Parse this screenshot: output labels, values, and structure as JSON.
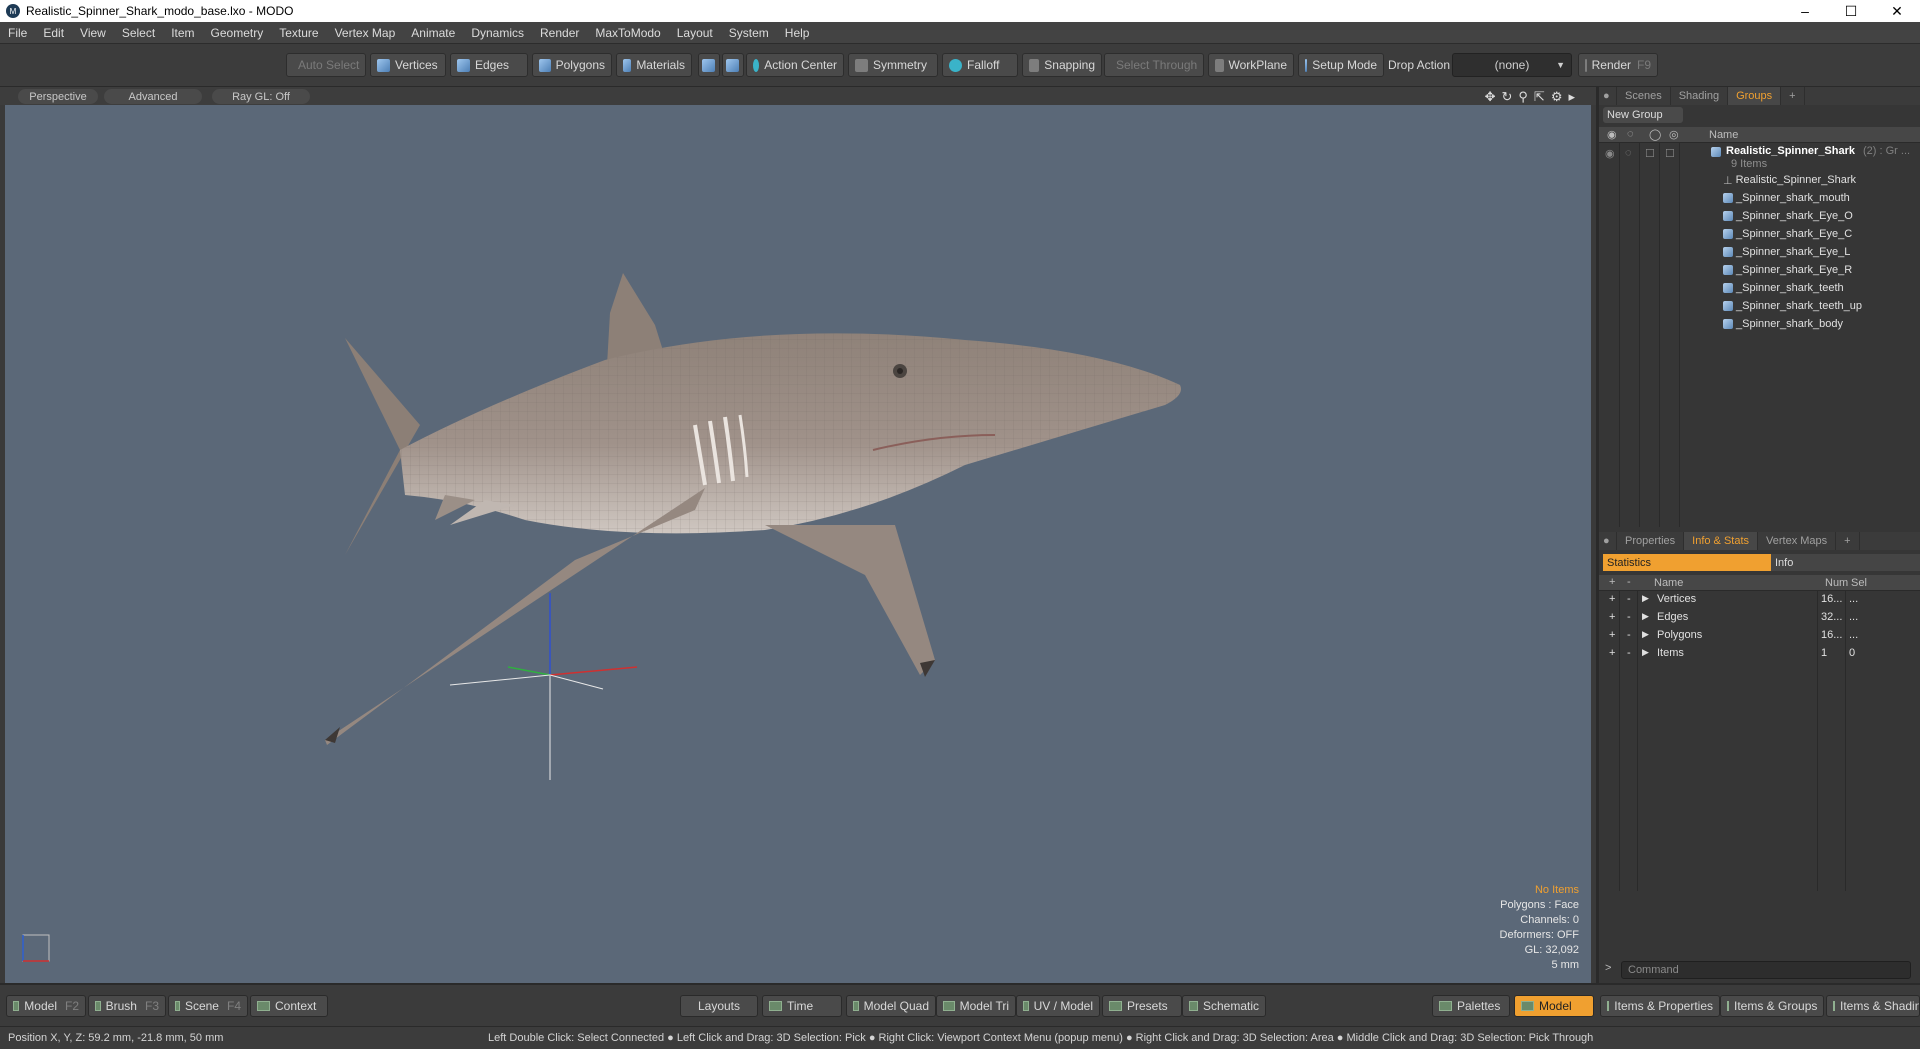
{
  "window": {
    "title": "Realistic_Spinner_Shark_modo_base.lxo - MODO"
  },
  "menu": [
    "File",
    "Edit",
    "View",
    "Select",
    "Item",
    "Geometry",
    "Texture",
    "Vertex Map",
    "Animate",
    "Dynamics",
    "Render",
    "MaxToModo",
    "Layout",
    "System",
    "Help"
  ],
  "toolbar": {
    "auto_select": "Auto Select",
    "vertices": "Vertices",
    "edges": "Edges",
    "polygons": "Polygons",
    "materials": "Materials",
    "action_center": "Action Center",
    "symmetry": "Symmetry",
    "falloff": "Falloff",
    "snapping": "Snapping",
    "select_through": "Select Through",
    "workplane": "WorkPlane",
    "setup_mode": "Setup Mode",
    "drop_action_label": "Drop Action",
    "drop_action_value": "(none)",
    "render": "Render",
    "render_key": "F9"
  },
  "viewport": {
    "tabs": [
      "Perspective",
      "Advanced",
      "Ray GL: Off"
    ],
    "overlay": {
      "no_items": "No Items",
      "polygons": "Polygons : Face",
      "channels": "Channels: 0",
      "deformers": "Deformers: OFF",
      "gl": "GL: 32,092",
      "scale": "5 mm"
    }
  },
  "groups_panel": {
    "tabs": [
      "Scenes",
      "Shading",
      "Groups"
    ],
    "new_group": "New Group",
    "col_name": "Name",
    "root": {
      "name": "Realistic_Spinner_Shark",
      "suffix": "(2) : Gr ...",
      "count": "9 Items"
    },
    "items": [
      "Realistic_Spinner_Shark",
      "_Spinner_shark_mouth",
      "_Spinner_shark_Eye_O",
      "_Spinner_shark_Eye_C",
      "_Spinner_shark_Eye_L",
      "_Spinner_shark_Eye_R",
      "_Spinner_shark_teeth",
      "_Spinner_shark_teeth_up",
      "_Spinner_shark_body"
    ]
  },
  "stats_panel": {
    "tabs": [
      "Properties",
      "Info & Stats",
      "Vertex Maps"
    ],
    "subtabs": [
      "Statistics",
      "Info"
    ],
    "columns": {
      "name": "Name",
      "num": "Num",
      "sel": "Sel"
    },
    "rows": [
      {
        "name": "Vertices",
        "num": "16...",
        "sel": "..."
      },
      {
        "name": "Edges",
        "num": "32...",
        "sel": "..."
      },
      {
        "name": "Polygons",
        "num": "16...",
        "sel": "..."
      },
      {
        "name": "Items",
        "num": "1",
        "sel": "0"
      }
    ],
    "command_placeholder": "Command"
  },
  "bottombar": {
    "model": "Model",
    "model_key": "F2",
    "brush": "Brush",
    "brush_key": "F3",
    "scene": "Scene",
    "scene_key": "F4",
    "context": "Context",
    "layouts": "Layouts",
    "time": "Time",
    "model_quad": "Model Quad",
    "model_tri": "Model Tri",
    "uv_model": "UV / Model",
    "presets": "Presets",
    "schematic": "Schematic",
    "palettes": "Palettes",
    "model_active": "Model",
    "items_properties": "Items & Properties",
    "items_groups": "Items & Groups",
    "items_shading": "Items & Shadin"
  },
  "statusbar": {
    "position": "Position X, Y, Z:   59.2 mm, -21.8 mm, 50 mm",
    "hints": "Left Double Click: Select Connected ● Left Click and Drag: 3D Selection: Pick ● Right Click: Viewport Context Menu (popup menu) ● Right Click and Drag: 3D Selection: Area ● Middle Click and Drag: 3D Selection: Pick Through"
  }
}
